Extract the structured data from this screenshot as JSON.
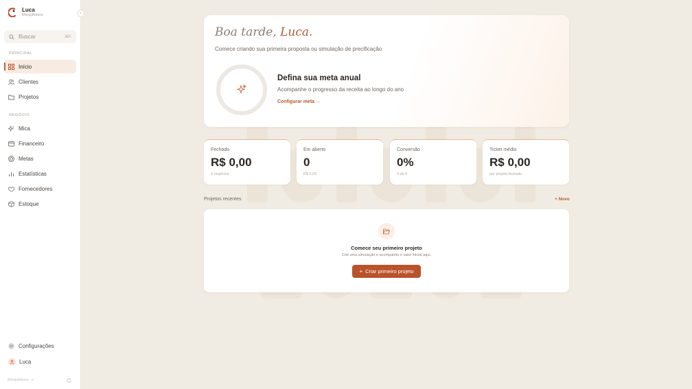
{
  "brand": {
    "name": "Luca",
    "subtitle": "Mioquitetura"
  },
  "search": {
    "placeholder": "Buscar",
    "shortcut": "⌘K"
  },
  "sidebar": {
    "section_main": "PRINCIPAL",
    "main_items": [
      {
        "label": "Início",
        "icon": "grid-icon",
        "active": true
      },
      {
        "label": "Clientes",
        "icon": "users-icon"
      },
      {
        "label": "Projetos",
        "icon": "folder-icon"
      }
    ],
    "section_business": "NEGÓCIO",
    "business_items": [
      {
        "label": "Mica",
        "icon": "sparkle-icon"
      },
      {
        "label": "Financeiro",
        "icon": "wallet-icon"
      },
      {
        "label": "Metas",
        "icon": "target-icon"
      },
      {
        "label": "Estatísticas",
        "icon": "bar-chart-icon"
      },
      {
        "label": "Fornecedores",
        "icon": "handshake-icon"
      },
      {
        "label": "Estoque",
        "icon": "box-icon"
      }
    ],
    "settings_label": "Configurações",
    "user_label": "Luca",
    "footer_text": "Mioquitetura · v"
  },
  "hero": {
    "greeting_prefix": "Boa tarde,",
    "greeting_name": "Luca.",
    "subtitle": "Comece criando sua primeira proposta ou simulação de precificação",
    "goal_title": "Defina sua meta anual",
    "goal_subtitle": "Acompanhe o progresso da receita ao longo do ano",
    "goal_link": "Configurar meta →",
    "goal_progress": 0
  },
  "stats": [
    {
      "label": "Fechado",
      "value": "R$ 0,00",
      "note": "0 negócios"
    },
    {
      "label": "Em aberto",
      "value": "0",
      "note": "R$ 0,00"
    },
    {
      "label": "Conversão",
      "value": "0%",
      "note": "0 de 0"
    },
    {
      "label": "Ticket médio",
      "value": "R$ 0,00",
      "note": "por projeto fechado"
    }
  ],
  "recent": {
    "title": "Projetos recentes",
    "new_label": "+ Novo",
    "empty_title": "Comece seu primeiro projeto",
    "empty_subtitle": "Crie uma simulação e acompanhe o valor inicial aqui.",
    "cta_label": "Criar primeiro projeto"
  },
  "colors": {
    "accent": "#b9532a",
    "background": "#f1ece3"
  }
}
